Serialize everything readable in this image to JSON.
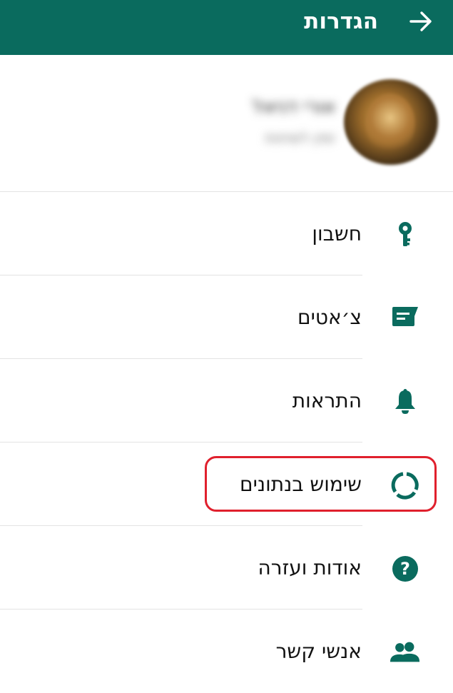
{
  "appbar": {
    "title": "הגדרות",
    "back_icon": "arrow-right-icon",
    "color": "#0a6b5e"
  },
  "profile": {
    "name": "אורי דניאל",
    "status": "זמין לשיחות"
  },
  "menu": [
    {
      "label": "חשבון",
      "icon": "key-icon"
    },
    {
      "label": "צ׳אטים",
      "icon": "chat-icon"
    },
    {
      "label": "התראות",
      "icon": "bell-icon"
    },
    {
      "label": "שימוש בנתונים",
      "icon": "data-usage-icon",
      "highlighted": true
    },
    {
      "label": "אודות ועזרה",
      "icon": "help-icon"
    },
    {
      "label": "אנשי קשר",
      "icon": "contacts-icon"
    }
  ],
  "colors": {
    "accent": "#0a6b5e",
    "highlight": "#e0202d"
  }
}
